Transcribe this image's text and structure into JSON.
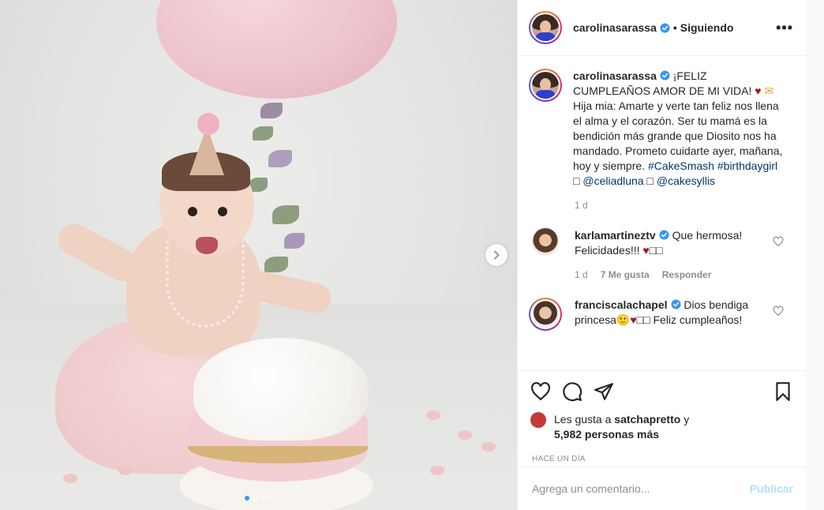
{
  "post": {
    "username": "carolinasarassa",
    "follow_separator": "•",
    "follow_status": "Siguiendo",
    "more_label": "•••"
  },
  "caption": {
    "username": "carolinasarassa",
    "text_part1": "¡FELIZ CUMPLEAÑOS AMOR DE MI VIDA!",
    "heart": "♥",
    "envelope": "✉",
    "text_part2": "Hija mia: Amarte y verte tan feliz nos llena el alma y el corazón. Ser tu mamá es la bendición más grande que Diosito nos ha mandado. Prometo cuidarte ayer, mañana, hoy y siempre.",
    "hashtags": "#CakeSmash #birthdaygirl",
    "box1": "□",
    "mention1": "@celiadluna",
    "box2": "□",
    "mention2": "@cakesyllis",
    "time": "1 d"
  },
  "comments": [
    {
      "username": "karlamartineztv",
      "text": "Que hermosa! Felicidades!!!",
      "heart": "♥",
      "boxes": "□□",
      "time": "1 d",
      "likes": "7 Me gusta",
      "reply": "Responder"
    },
    {
      "username": "franciscalachapel",
      "text": "Dios bendiga princesa",
      "emoji": "🙂",
      "heart": "♥",
      "boxes": "□□",
      "text2": "Feliz cumpleaños!"
    }
  ],
  "likes": {
    "prefix": "Les gusta a",
    "user": "satchapretto",
    "conj": "y",
    "count_text": "5,982 personas más"
  },
  "timestamp": "HACE UN DÍA",
  "add_comment": {
    "placeholder": "Agrega un comentario...",
    "post_label": "Publicar"
  },
  "carousel": {
    "dots": 4,
    "active_index": 0
  },
  "colors": {
    "verified": "#3897f0",
    "link": "#00376b",
    "post_disabled": "#b2dffc",
    "muted": "#8e8e8e"
  }
}
